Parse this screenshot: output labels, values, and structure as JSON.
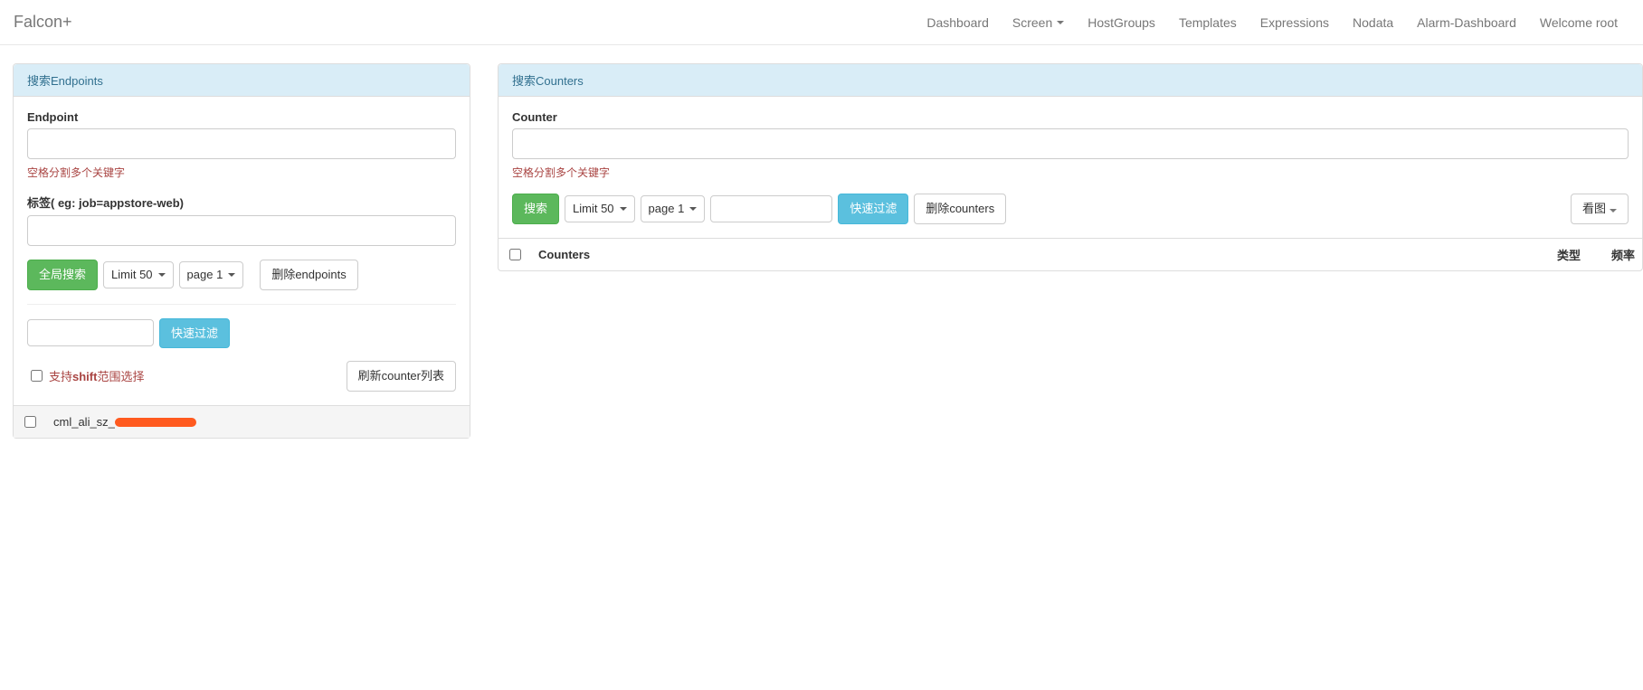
{
  "brand": "Falcon+",
  "nav": {
    "dashboard": "Dashboard",
    "screen": "Screen",
    "hostgroups": "HostGroups",
    "templates": "Templates",
    "expressions": "Expressions",
    "nodata": "Nodata",
    "alarm_dashboard": "Alarm-Dashboard",
    "welcome": "Welcome root"
  },
  "endpoints_panel": {
    "heading": "搜索Endpoints",
    "endpoint_label": "Endpoint",
    "endpoint_hint": "空格分割多个关键字",
    "tags_label": "标签( eg: job=appstore-web)",
    "search_btn": "全局搜索",
    "limit_select": "Limit 50",
    "page_select": "page 1",
    "delete_btn": "删除endpoints",
    "fast_filter_btn": "快速过滤",
    "shift_label_pre": "支持",
    "shift_bold": "shift",
    "shift_label_post": "范围选择",
    "refresh_btn": "刷新counter列表",
    "rows": [
      {
        "name": "cml_ali_sz_"
      }
    ]
  },
  "counters_panel": {
    "heading": "搜索Counters",
    "counter_label": "Counter",
    "counter_hint": "空格分割多个关键字",
    "search_btn": "搜索",
    "limit_select": "Limit 50",
    "page_select": "page 1",
    "fast_filter_btn": "快速过滤",
    "delete_btn": "删除counters",
    "view_btn": "看图",
    "table": {
      "col_counters": "Counters",
      "col_type": "类型",
      "col_freq": "频率"
    }
  }
}
